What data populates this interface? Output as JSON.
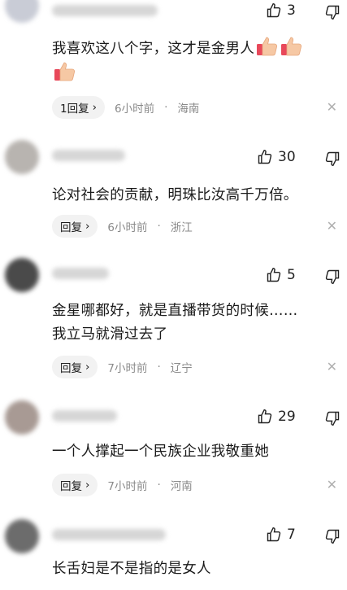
{
  "comments": [
    {
      "likes": "3",
      "lines": [
        "我喜欢这八个字，这才是金男人"
      ],
      "reply_label": "1回复",
      "time": "6小时前",
      "location": "海南"
    },
    {
      "likes": "30",
      "lines": [
        "论对社会的贡献，明珠比汝高千万倍。"
      ],
      "reply_label": "回复",
      "time": "6小时前",
      "location": "浙江"
    },
    {
      "likes": "5",
      "lines": [
        "金星哪都好，就是直播带货的时候……",
        "我立马就滑过去了"
      ],
      "reply_label": "回复",
      "time": "7小时前",
      "location": "辽宁"
    },
    {
      "likes": "29",
      "lines": [
        "一个人撑起一个民族企业我敬重她"
      ],
      "reply_label": "回复",
      "time": "7小时前",
      "location": "河南"
    },
    {
      "likes": "7",
      "lines": [
        "长舌妇是不是指的是女人"
      ]
    }
  ],
  "icons": {
    "like": "thumbs-up-icon",
    "dislike": "thumbs-down-icon",
    "close": "close-icon",
    "emoji": "thumbs-up-emoji"
  },
  "separator": "·",
  "chevron": "›",
  "close_glyph": "✕"
}
